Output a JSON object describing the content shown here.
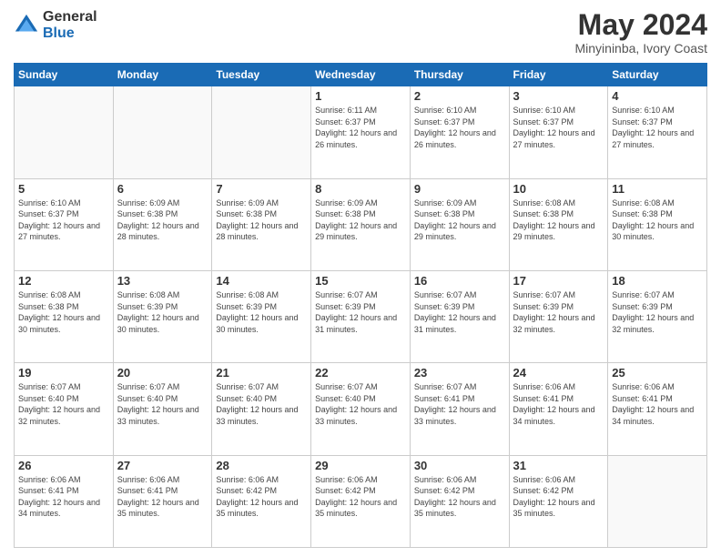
{
  "logo": {
    "general": "General",
    "blue": "Blue"
  },
  "header": {
    "title": "May 2024",
    "subtitle": "Minyininba, Ivory Coast"
  },
  "days_of_week": [
    "Sunday",
    "Monday",
    "Tuesday",
    "Wednesday",
    "Thursday",
    "Friday",
    "Saturday"
  ],
  "weeks": [
    [
      {
        "day": "",
        "sunrise": "",
        "sunset": "",
        "daylight": ""
      },
      {
        "day": "",
        "sunrise": "",
        "sunset": "",
        "daylight": ""
      },
      {
        "day": "",
        "sunrise": "",
        "sunset": "",
        "daylight": ""
      },
      {
        "day": "1",
        "sunrise": "Sunrise: 6:11 AM",
        "sunset": "Sunset: 6:37 PM",
        "daylight": "Daylight: 12 hours and 26 minutes."
      },
      {
        "day": "2",
        "sunrise": "Sunrise: 6:10 AM",
        "sunset": "Sunset: 6:37 PM",
        "daylight": "Daylight: 12 hours and 26 minutes."
      },
      {
        "day": "3",
        "sunrise": "Sunrise: 6:10 AM",
        "sunset": "Sunset: 6:37 PM",
        "daylight": "Daylight: 12 hours and 27 minutes."
      },
      {
        "day": "4",
        "sunrise": "Sunrise: 6:10 AM",
        "sunset": "Sunset: 6:37 PM",
        "daylight": "Daylight: 12 hours and 27 minutes."
      }
    ],
    [
      {
        "day": "5",
        "sunrise": "Sunrise: 6:10 AM",
        "sunset": "Sunset: 6:37 PM",
        "daylight": "Daylight: 12 hours and 27 minutes."
      },
      {
        "day": "6",
        "sunrise": "Sunrise: 6:09 AM",
        "sunset": "Sunset: 6:38 PM",
        "daylight": "Daylight: 12 hours and 28 minutes."
      },
      {
        "day": "7",
        "sunrise": "Sunrise: 6:09 AM",
        "sunset": "Sunset: 6:38 PM",
        "daylight": "Daylight: 12 hours and 28 minutes."
      },
      {
        "day": "8",
        "sunrise": "Sunrise: 6:09 AM",
        "sunset": "Sunset: 6:38 PM",
        "daylight": "Daylight: 12 hours and 29 minutes."
      },
      {
        "day": "9",
        "sunrise": "Sunrise: 6:09 AM",
        "sunset": "Sunset: 6:38 PM",
        "daylight": "Daylight: 12 hours and 29 minutes."
      },
      {
        "day": "10",
        "sunrise": "Sunrise: 6:08 AM",
        "sunset": "Sunset: 6:38 PM",
        "daylight": "Daylight: 12 hours and 29 minutes."
      },
      {
        "day": "11",
        "sunrise": "Sunrise: 6:08 AM",
        "sunset": "Sunset: 6:38 PM",
        "daylight": "Daylight: 12 hours and 30 minutes."
      }
    ],
    [
      {
        "day": "12",
        "sunrise": "Sunrise: 6:08 AM",
        "sunset": "Sunset: 6:38 PM",
        "daylight": "Daylight: 12 hours and 30 minutes."
      },
      {
        "day": "13",
        "sunrise": "Sunrise: 6:08 AM",
        "sunset": "Sunset: 6:39 PM",
        "daylight": "Daylight: 12 hours and 30 minutes."
      },
      {
        "day": "14",
        "sunrise": "Sunrise: 6:08 AM",
        "sunset": "Sunset: 6:39 PM",
        "daylight": "Daylight: 12 hours and 30 minutes."
      },
      {
        "day": "15",
        "sunrise": "Sunrise: 6:07 AM",
        "sunset": "Sunset: 6:39 PM",
        "daylight": "Daylight: 12 hours and 31 minutes."
      },
      {
        "day": "16",
        "sunrise": "Sunrise: 6:07 AM",
        "sunset": "Sunset: 6:39 PM",
        "daylight": "Daylight: 12 hours and 31 minutes."
      },
      {
        "day": "17",
        "sunrise": "Sunrise: 6:07 AM",
        "sunset": "Sunset: 6:39 PM",
        "daylight": "Daylight: 12 hours and 32 minutes."
      },
      {
        "day": "18",
        "sunrise": "Sunrise: 6:07 AM",
        "sunset": "Sunset: 6:39 PM",
        "daylight": "Daylight: 12 hours and 32 minutes."
      }
    ],
    [
      {
        "day": "19",
        "sunrise": "Sunrise: 6:07 AM",
        "sunset": "Sunset: 6:40 PM",
        "daylight": "Daylight: 12 hours and 32 minutes."
      },
      {
        "day": "20",
        "sunrise": "Sunrise: 6:07 AM",
        "sunset": "Sunset: 6:40 PM",
        "daylight": "Daylight: 12 hours and 33 minutes."
      },
      {
        "day": "21",
        "sunrise": "Sunrise: 6:07 AM",
        "sunset": "Sunset: 6:40 PM",
        "daylight": "Daylight: 12 hours and 33 minutes."
      },
      {
        "day": "22",
        "sunrise": "Sunrise: 6:07 AM",
        "sunset": "Sunset: 6:40 PM",
        "daylight": "Daylight: 12 hours and 33 minutes."
      },
      {
        "day": "23",
        "sunrise": "Sunrise: 6:07 AM",
        "sunset": "Sunset: 6:41 PM",
        "daylight": "Daylight: 12 hours and 33 minutes."
      },
      {
        "day": "24",
        "sunrise": "Sunrise: 6:06 AM",
        "sunset": "Sunset: 6:41 PM",
        "daylight": "Daylight: 12 hours and 34 minutes."
      },
      {
        "day": "25",
        "sunrise": "Sunrise: 6:06 AM",
        "sunset": "Sunset: 6:41 PM",
        "daylight": "Daylight: 12 hours and 34 minutes."
      }
    ],
    [
      {
        "day": "26",
        "sunrise": "Sunrise: 6:06 AM",
        "sunset": "Sunset: 6:41 PM",
        "daylight": "Daylight: 12 hours and 34 minutes."
      },
      {
        "day": "27",
        "sunrise": "Sunrise: 6:06 AM",
        "sunset": "Sunset: 6:41 PM",
        "daylight": "Daylight: 12 hours and 35 minutes."
      },
      {
        "day": "28",
        "sunrise": "Sunrise: 6:06 AM",
        "sunset": "Sunset: 6:42 PM",
        "daylight": "Daylight: 12 hours and 35 minutes."
      },
      {
        "day": "29",
        "sunrise": "Sunrise: 6:06 AM",
        "sunset": "Sunset: 6:42 PM",
        "daylight": "Daylight: 12 hours and 35 minutes."
      },
      {
        "day": "30",
        "sunrise": "Sunrise: 6:06 AM",
        "sunset": "Sunset: 6:42 PM",
        "daylight": "Daylight: 12 hours and 35 minutes."
      },
      {
        "day": "31",
        "sunrise": "Sunrise: 6:06 AM",
        "sunset": "Sunset: 6:42 PM",
        "daylight": "Daylight: 12 hours and 35 minutes."
      },
      {
        "day": "",
        "sunrise": "",
        "sunset": "",
        "daylight": ""
      }
    ]
  ]
}
